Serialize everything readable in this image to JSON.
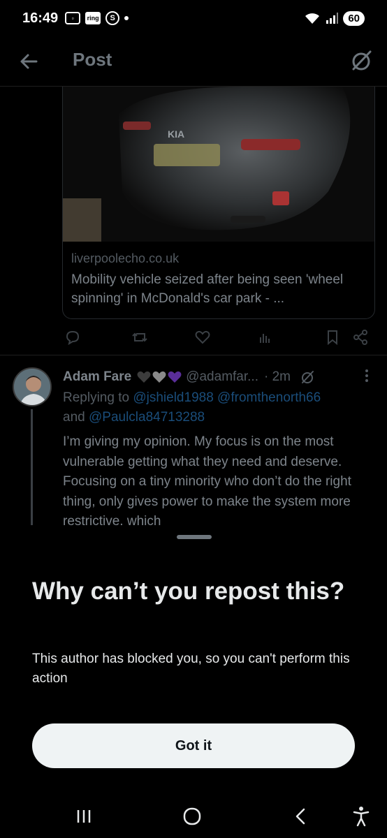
{
  "status_bar": {
    "time": "16:49",
    "icons_left": [
      "screenshot-icon",
      "ring-icon",
      "s-app-icon",
      "dot"
    ],
    "ring_label": "ring",
    "s_label": "S",
    "battery": "60"
  },
  "header": {
    "title": "Post"
  },
  "link_card": {
    "domain": "liverpoolecho.co.uk",
    "title": "Mobility vehicle seized after being seen 'wheel spinning' in McDonald's car park - ...",
    "image_plate_text": "KIA"
  },
  "reply": {
    "name": "Adam Fare",
    "handle": "@adamfar...",
    "time": "· 2m",
    "replying_prefix": "Replying to ",
    "replying_handle_1": "@jshield1988",
    "replying_handle_2": "@fromthenorth66",
    "replying_and": "and ",
    "replying_handle_3": "@Paulcla84713288",
    "text": "I’m giving my opinion. My focus is on the most vulnerable getting what they need and deserve. Focusing on a tiny minority who don’t do the right thing, only gives power to make the system more restrictive, which"
  },
  "sheet": {
    "title": "Why can’t you repost this?",
    "body": "This author has blocked you, so you can't perform this action",
    "button": "Got it"
  },
  "colors": {
    "background": "#000000",
    "button_bg": "#eff3f4",
    "dim_text": "#7d848b",
    "link": "#1a4d7a",
    "heart_purple": "#7b3fd1"
  }
}
